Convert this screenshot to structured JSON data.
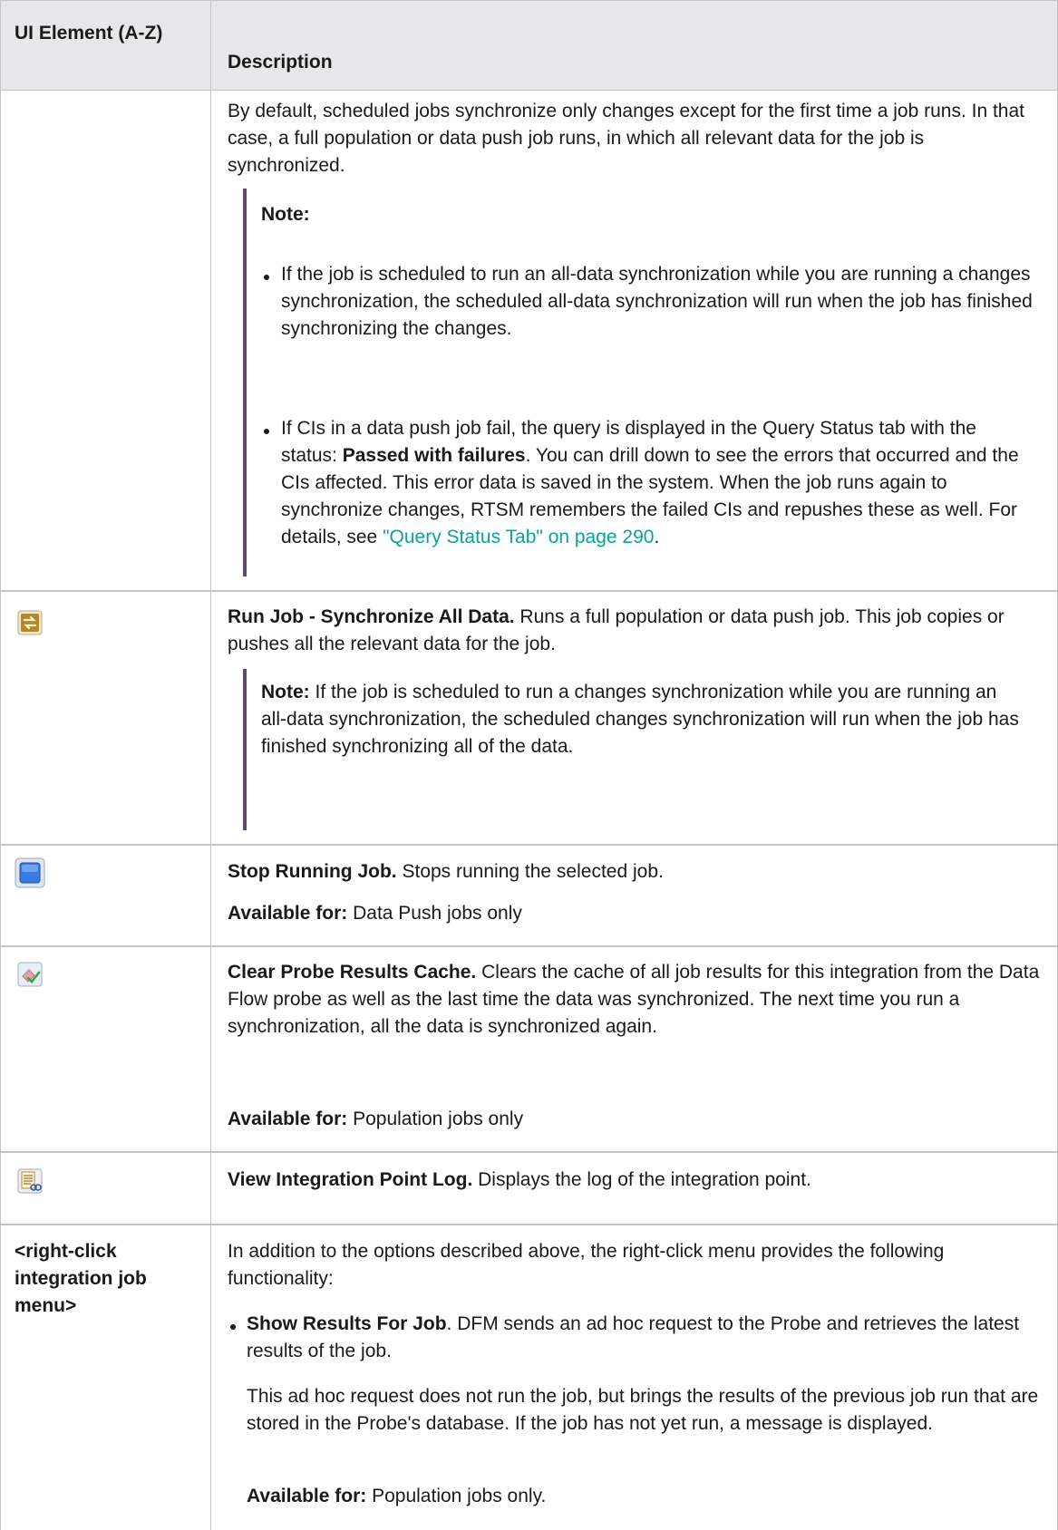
{
  "header": {
    "col1": "UI Element (A-Z)",
    "col2": "Description"
  },
  "rows": {
    "intro": {
      "para": "By default, scheduled jobs synchronize only changes except for the first time a job runs. In that case, a full population or data push job runs, in which all relevant data for the job is synchronized.",
      "note_label": "Note:",
      "bullet1": "If the job is scheduled to run an all-data synchronization while you are running a changes synchronization, the scheduled all-data synchronization will run when the job has finished synchronizing the changes.",
      "bullet2_a": "If CIs in a data push job fail, the query is displayed in the Query Status tab with the status: ",
      "bullet2_bold": "Passed with failures",
      "bullet2_b": ". You can drill down to see the errors that occurred and the CIs affected. This error data is saved in the system. When the job runs again to synchronize changes, RTSM remembers the failed CIs and repushes these as well. For details, see ",
      "bullet2_link": "\"Query Status Tab\" on page 290",
      "bullet2_end": "."
    },
    "run_all": {
      "icon": "sync-all-icon",
      "title": "Run Job - Synchronize All Data.",
      "text": " Runs a full population or data push job. This job copies or pushes all the relevant data for the job.",
      "note_label": "Note:",
      "note_text": "  If the job is scheduled to run a changes synchronization while you are running an all-data synchronization, the scheduled changes synchronization will run when the job has finished synchronizing all of the data."
    },
    "stop": {
      "icon": "stop-icon",
      "title": "Stop Running Job.",
      "text": " Stops running the selected job.",
      "avail_label": "Available for:",
      "avail_text": " Data Push jobs only"
    },
    "clear": {
      "icon": "eraser-check-icon",
      "title": "Clear Probe Results Cache.",
      "text": " Clears the cache of all job results for this integration from the Data Flow probe as well as the last time the data was synchronized. The next time you run a synchronization, all the data is synchronized again.",
      "avail_label": "Available for:",
      "avail_text": " Population jobs only"
    },
    "log": {
      "icon": "log-view-icon",
      "title": "View Integration Point Log.",
      "text": " Displays the log of the integration point."
    },
    "rightclick": {
      "element": "<right-click integration job menu>",
      "intro": "In addition to the options described above, the right-click menu provides the following functionality:",
      "bullet_title": "Show Results For Job",
      "bullet_text": ". DFM sends an ad hoc request to the Probe and retrieves the latest results of the job.",
      "sub_para": "This ad hoc request does not run the job, but brings the results of the previous job run that are stored in the Probe's database. If the job has not yet run, a message is displayed.",
      "avail_label": "Available for:",
      "avail_text": " Population jobs only."
    }
  }
}
